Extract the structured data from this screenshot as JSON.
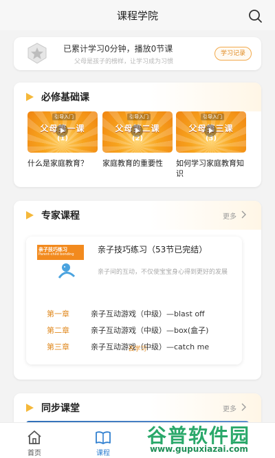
{
  "header": {
    "title": "课程学院"
  },
  "stats": {
    "summary": "已累计学习0分钟，播放0节课",
    "slogan": "父母是孩子的榜样，让学习成为习惯",
    "record_button": "学习记录"
  },
  "required": {
    "title": "必修基础课",
    "items": [
      {
        "thumb_tag": "引导入门",
        "thumb_text": "父母第一课",
        "thumb_num": "(1)",
        "name": "什么是家庭教育？"
      },
      {
        "thumb_tag": "引导入门",
        "thumb_text": "父母第二课",
        "thumb_num": "(2)",
        "name": "家庭教育的重要性"
      },
      {
        "thumb_tag": "引导入门",
        "thumb_text": "父母第三课",
        "thumb_num": "(3)",
        "name": "如何学习家庭教育知识"
      }
    ]
  },
  "expert": {
    "title": "专家课程",
    "more": "更多",
    "course": {
      "cover_title": "亲子技巧练习",
      "cover_sub": "Parent-child bonding",
      "title": "亲子技巧练习（53节已完结）",
      "desc": "亲子间的互动，不仅使宝宝身心得到更好的发展",
      "chapters": [
        {
          "chapter": "第一章",
          "lesson": "亲子互动游戏（中级）—blast off"
        },
        {
          "chapter": "第二章",
          "lesson": "亲子互动游戏（中级）—box(盒子)"
        },
        {
          "chapter": "第三章",
          "lesson": "亲子互动游戏（中级）—catch me"
        }
      ],
      "go_label": "去学习"
    }
  },
  "sync": {
    "title": "同步课堂",
    "more": "更多"
  },
  "nav": {
    "items": [
      {
        "label": "首页",
        "active": false
      },
      {
        "label": "课程",
        "active": true
      }
    ]
  },
  "watermark": {
    "line1": "谷普软件园",
    "line2": "www.gupuxiazai.com"
  },
  "colors": {
    "accent": "#e08a20",
    "nav_active": "#2f7fd0",
    "nav_inactive": "#555555"
  }
}
